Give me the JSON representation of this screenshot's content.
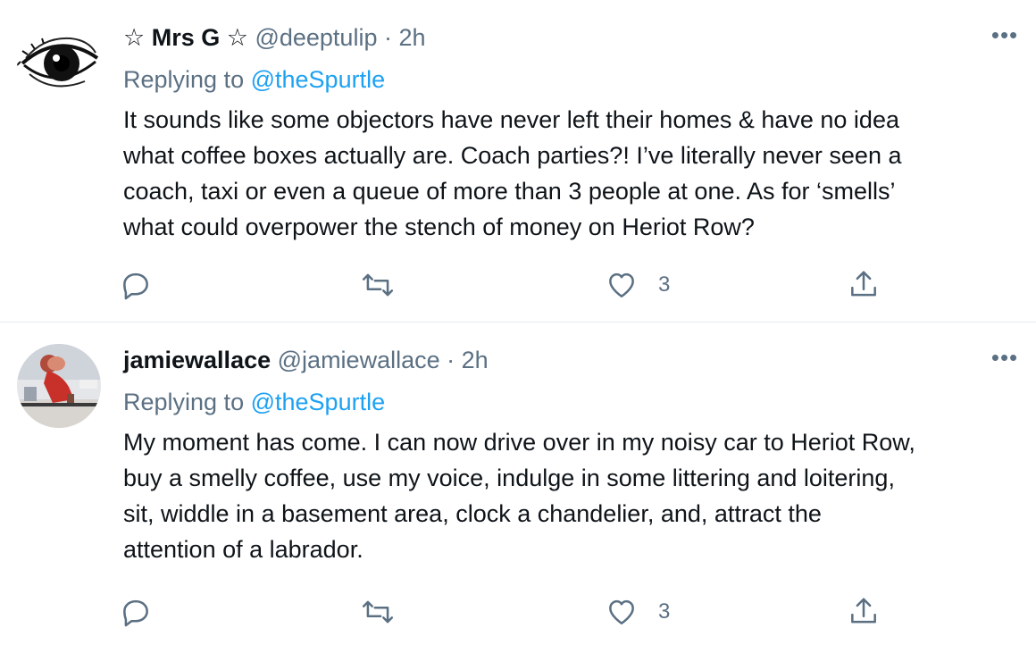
{
  "tweets": [
    {
      "name": "☆ Mrs G ☆",
      "handle": "@deeptulip",
      "separator": "·",
      "time": "2h",
      "replying_prefix": "Replying to",
      "replying_to": "@theSpurtle",
      "text": "It sounds like some objectors have never left their homes & have no idea\nwhat coffee boxes actually are. Coach parties?! I’ve literally never seen a\ncoach, taxi or even a queue of more than 3 people at one. As for ‘smells’\nwhat could overpower the stench of money on Heriot Row?",
      "likes": "3",
      "more_label": "•••",
      "avatar": "eye-drawing-avatar"
    },
    {
      "name": "jamiewallace",
      "handle": "@jamiewallace",
      "separator": "·",
      "time": "2h",
      "replying_prefix": "Replying to",
      "replying_to": "@theSpurtle",
      "text": "My moment has come. I can now drive over in my noisy car to Heriot Row,\nbuy a smelly coffee, use my voice, indulge in some littering and loitering,\nsit, widdle in a basement area, clock a chandelier, and, attract the\nattention of a labrador.",
      "likes": "3",
      "more_label": "•••",
      "avatar": "photo-avatar"
    }
  ],
  "icons": {
    "reply": "speech-bubble-icon",
    "retweet": "retweet-icon",
    "like": "heart-icon",
    "share": "share-icon",
    "more": "more-dots-icon"
  },
  "colors": {
    "link": "#1da1f2",
    "secondary_text": "#5b7083",
    "primary_text": "#0f1419",
    "divider": "#e6ecf0"
  }
}
